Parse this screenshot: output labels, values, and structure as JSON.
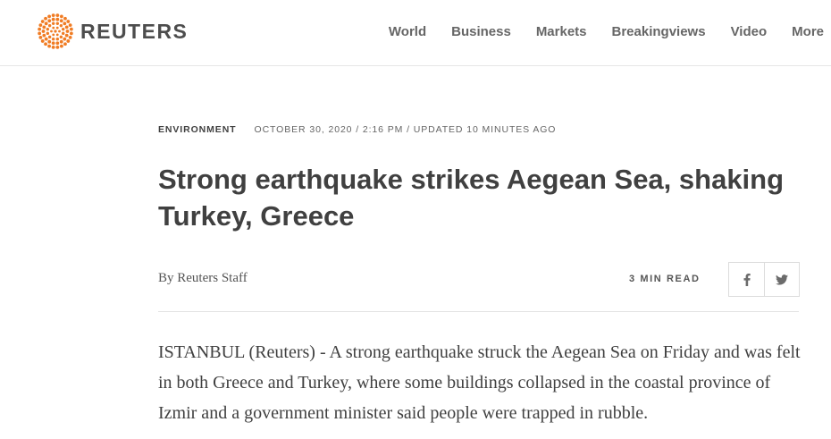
{
  "brand": {
    "name": "REUTERS",
    "accent_color": "#f07c24"
  },
  "nav": {
    "items": [
      {
        "label": "World"
      },
      {
        "label": "Business"
      },
      {
        "label": "Markets"
      },
      {
        "label": "Breakingviews"
      },
      {
        "label": "Video"
      },
      {
        "label": "More"
      }
    ]
  },
  "article": {
    "section": "ENVIRONMENT",
    "dateline": "OCTOBER 30, 2020 / 2:16 PM / UPDATED 10 MINUTES AGO",
    "headline": "Strong earthquake strikes Aegean Sea, shaking Turkey, Greece",
    "byline_prefix": "By",
    "author": "Reuters Staff",
    "read_time": "3 MIN READ",
    "share": {
      "facebook_icon": "facebook-icon",
      "twitter_icon": "twitter-icon"
    },
    "body": "ISTANBUL (Reuters) - A strong earthquake struck the Aegean Sea on Friday and was felt in both Greece and Turkey, where some buildings collapsed in the coastal province of Izmir and a government minister said people were trapped in rubble."
  }
}
